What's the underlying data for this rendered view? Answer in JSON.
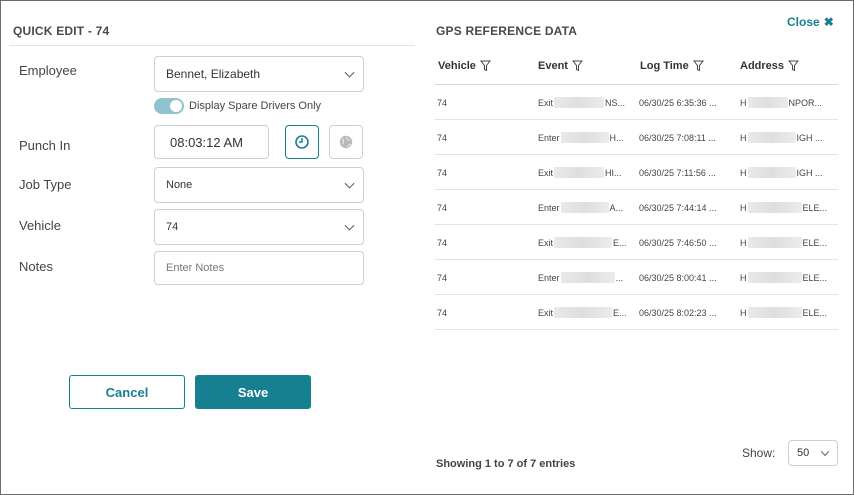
{
  "quick_edit": {
    "title": "QUICK EDIT - 74",
    "employee_label": "Employee",
    "employee_value": "Bennet, Elizabeth",
    "spare_toggle_label": "Display Spare Drivers Only",
    "punch_in_label": "Punch In",
    "punch_in_value": "08:03:12 AM",
    "job_type_label": "Job Type",
    "job_type_value": "None",
    "vehicle_label": "Vehicle",
    "vehicle_value": "74",
    "notes_label": "Notes",
    "notes_placeholder": "Enter Notes",
    "cancel_label": "Cancel",
    "save_label": "Save",
    "accent_color": "#177f92"
  },
  "gps": {
    "title": "GPS REFERENCE DATA",
    "close_label": "Close",
    "columns": [
      "Vehicle",
      "Event",
      "Log Time",
      "Address"
    ],
    "rows": [
      {
        "vehicle": "74",
        "event_pre": "Exit",
        "event_post": "NS...",
        "time": "06/30/25 6:35:36 ...",
        "addr_pre": "H",
        "addr_post": "NPOR..."
      },
      {
        "vehicle": "74",
        "event_pre": "Enter",
        "event_post": "H...",
        "time": "06/30/25 7:08:11 ...",
        "addr_pre": "H",
        "addr_post": "IGH ..."
      },
      {
        "vehicle": "74",
        "event_pre": "Exit",
        "event_post": "HI...",
        "time": "06/30/25 7:11:56 ...",
        "addr_pre": "H",
        "addr_post": "IGH ..."
      },
      {
        "vehicle": "74",
        "event_pre": "Enter",
        "event_post": "A...",
        "time": "06/30/25 7:44:14 ...",
        "addr_pre": "H",
        "addr_post": "ELE..."
      },
      {
        "vehicle": "74",
        "event_pre": "Exit",
        "event_post": "E...",
        "time": "06/30/25 7:46:50 ...",
        "addr_pre": "H",
        "addr_post": "ELE..."
      },
      {
        "vehicle": "74",
        "event_pre": "Enter",
        "event_post": "...",
        "time": "06/30/25 8:00:41 ...",
        "addr_pre": "H",
        "addr_post": "ELE..."
      },
      {
        "vehicle": "74",
        "event_pre": "Exit",
        "event_post": "E...",
        "time": "06/30/25 8:02:23 ...",
        "addr_pre": "H",
        "addr_post": "ELE..."
      }
    ],
    "showing_text": "Showing 1 to 7 of 7 entries",
    "show_label": "Show:",
    "page_size": "50"
  }
}
